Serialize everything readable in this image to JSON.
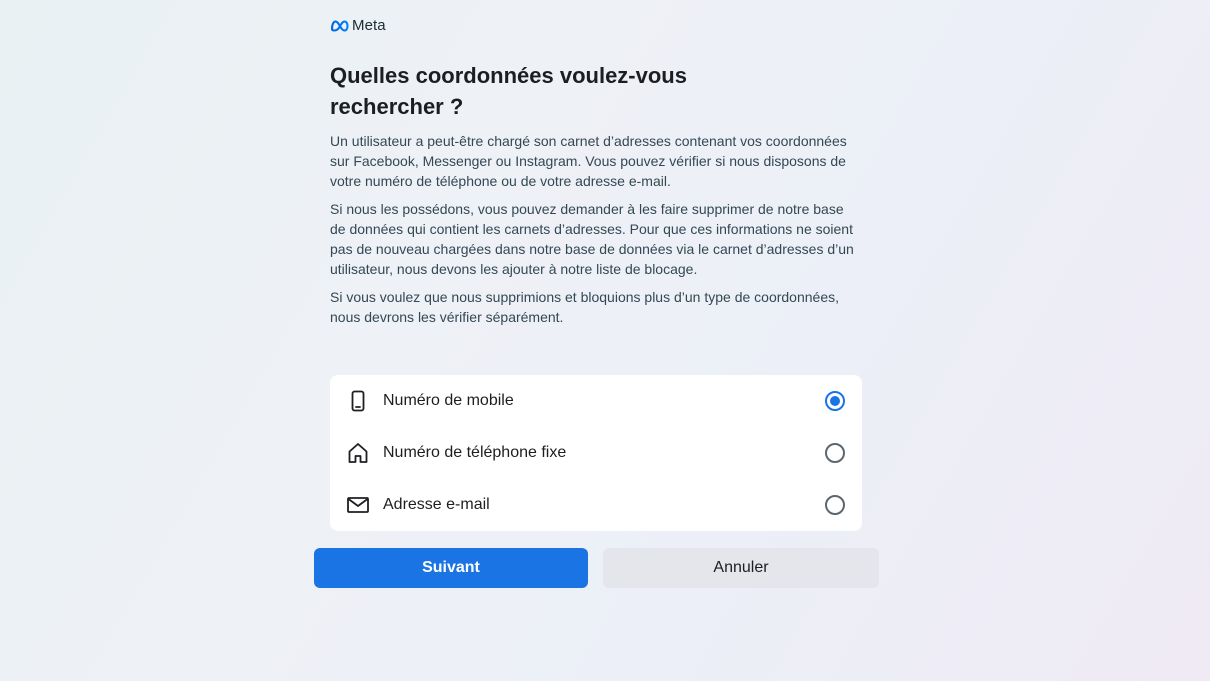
{
  "brand": {
    "name": "Meta",
    "logo_icon": "meta-infinity-logo",
    "accent_color": "#1b74e4"
  },
  "heading": "Quelles coordonnées voulez-vous rechercher ?",
  "paragraphs": [
    "Un utilisateur a peut-être chargé son carnet d’adresses contenant vos coordonnées sur Facebook, Messenger ou Instagram. Vous pouvez vérifier si nous disposons de votre numéro de téléphone ou de votre adresse e-mail.",
    "Si nous les possédons, vous pouvez demander à les faire supprimer de notre base de données qui contient les carnets d’adresses. Pour que ces informations ne soient pas de nouveau chargées dans notre base de données via le carnet d’adresses d’un utilisateur, nous devons les ajouter à notre liste de blocage.",
    "Si vous voulez que nous supprimions et bloquions plus d’un type de coordonnées, nous devrons les vérifier séparément."
  ],
  "options": [
    {
      "label": "Numéro de mobile",
      "icon": "mobile-phone-icon",
      "selected": true
    },
    {
      "label": "Numéro de téléphone fixe",
      "icon": "home-icon",
      "selected": false
    },
    {
      "label": "Adresse e-mail",
      "icon": "envelope-icon",
      "selected": false
    }
  ],
  "buttons": {
    "next_label": "Suivant",
    "cancel_label": "Annuler"
  }
}
